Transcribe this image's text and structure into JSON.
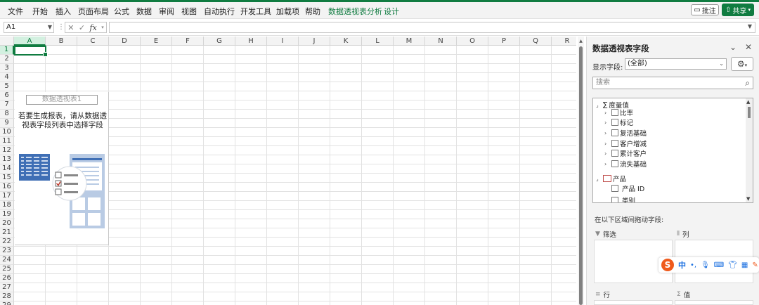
{
  "ribbon": {
    "tabs": [
      "文件",
      "开始",
      "插入",
      "页面布局",
      "公式",
      "数据",
      "审阅",
      "视图",
      "自动执行",
      "开发工具",
      "加载项",
      "帮助"
    ],
    "context_tabs": [
      "数据透视表分析",
      "设计"
    ],
    "comment_button": "批注",
    "share_button": "共享"
  },
  "formula_bar": {
    "name_box": "A1",
    "fx_label": "fx",
    "formula": ""
  },
  "grid": {
    "columns": [
      "A",
      "B",
      "C",
      "D",
      "E",
      "F",
      "G",
      "H",
      "I",
      "J",
      "K",
      "L",
      "M",
      "N",
      "O",
      "P",
      "Q",
      "R"
    ],
    "rows": [
      "1",
      "2",
      "3",
      "4",
      "5",
      "6",
      "7",
      "8",
      "9",
      "10",
      "11",
      "12",
      "13",
      "14",
      "15",
      "16",
      "17",
      "18",
      "19",
      "20",
      "21",
      "22",
      "23",
      "24",
      "25",
      "26",
      "27",
      "28",
      "29"
    ],
    "selected_column": "A",
    "selected_row": "1"
  },
  "pivot_placeholder": {
    "name": "数据透视表1",
    "hint": "若要生成报表，请从数据透视表字段列表中选择字段"
  },
  "pivot_panel": {
    "title": "数据透视表字段",
    "show_fields_label": "显示字段:",
    "show_fields_value": "(全部)",
    "search_placeholder": "搜索",
    "groups": [
      {
        "name": "度量值",
        "icon": "sigma-icon",
        "items": [
          "比率",
          "标记",
          "复活基础",
          "客户增减",
          "累计客户",
          "流失基础"
        ]
      },
      {
        "name": "产品",
        "icon": "table-icon",
        "items": [
          "产品 ID",
          "类别"
        ]
      }
    ],
    "drag_hint": "在以下区域间拖动字段:",
    "zones": {
      "filter": "筛选",
      "columns": "列",
      "rows": "行",
      "values": "值"
    }
  },
  "ime_toolbar": {
    "logo": "S",
    "lang": "中",
    "punct": "•,"
  },
  "colors": {
    "accent": "#107c41",
    "ime": "#ef5a1c"
  }
}
